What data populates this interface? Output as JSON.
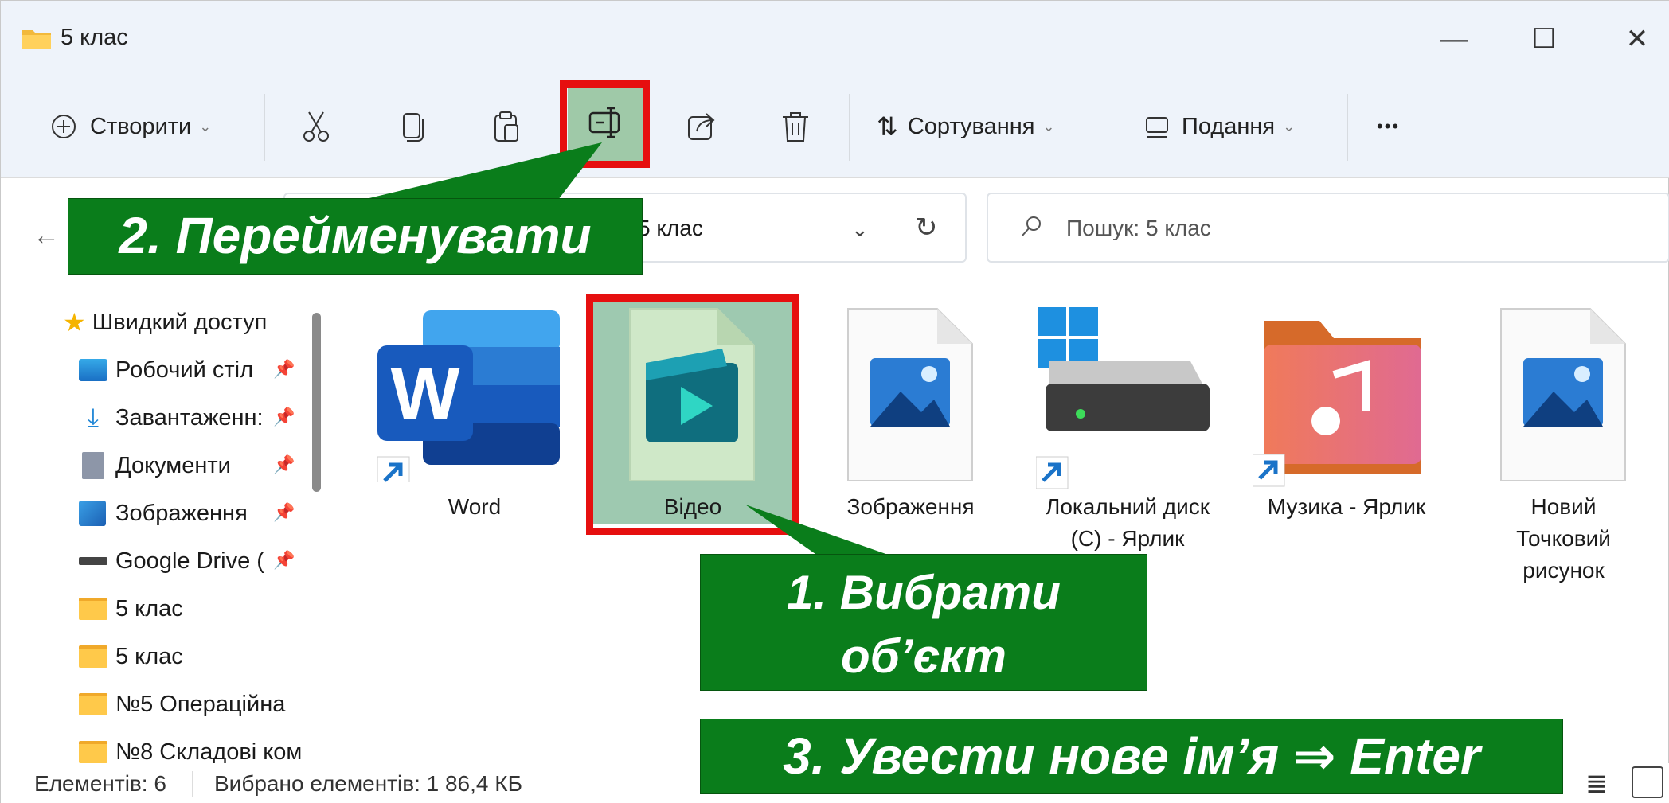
{
  "window": {
    "title": "5 клас",
    "controls": {
      "minimize": "—",
      "maximize": "☐",
      "close": "✕"
    }
  },
  "toolbar": {
    "create_label": "Створити",
    "sort_label": "Сортування",
    "view_label": "Подання",
    "more_label": "•••"
  },
  "address": {
    "path_visible": "5 клас",
    "search_placeholder": "Пошук: 5 клас"
  },
  "sidebar": {
    "items": [
      {
        "label": "Швидкий доступ",
        "icon": "star-icon"
      },
      {
        "label": "Робочий стіл",
        "icon": "desktop-icon",
        "pinned": true
      },
      {
        "label": "Завантаженн:",
        "icon": "download-icon",
        "pinned": true
      },
      {
        "label": "Документи",
        "icon": "document-icon",
        "pinned": true
      },
      {
        "label": "Зображення",
        "icon": "pictures-icon",
        "pinned": true
      },
      {
        "label": "Google Drive (",
        "icon": "drive-icon",
        "pinned": true
      },
      {
        "label": "5 клас",
        "icon": "folder-icon"
      },
      {
        "label": "5 клас",
        "icon": "folder-icon"
      },
      {
        "label": "№5 Операційна",
        "icon": "folder-icon"
      },
      {
        "label": "№8 Складові ком",
        "icon": "folder-icon"
      }
    ]
  },
  "files": [
    {
      "name": "Word",
      "icon": "word-icon",
      "shortcut": true
    },
    {
      "name": "Відео",
      "icon": "video-file-icon",
      "selected": true
    },
    {
      "name": "Зображення",
      "icon": "image-file-icon"
    },
    {
      "name_line1": "Локальний диск",
      "name_line2": "(C) - Ярлик",
      "icon": "local-disk-icon",
      "shortcut": true
    },
    {
      "name": "Музика - Ярлик",
      "icon": "music-folder-icon",
      "shortcut": true
    },
    {
      "name_line1": "Новий",
      "name_line2": "Точковий",
      "name_line3": "рисунок",
      "icon": "bitmap-file-icon"
    }
  ],
  "status": {
    "count": "Елементів: 6",
    "selected": "Вибрано елементів: 1  86,4 КБ"
  },
  "annotations": {
    "step1_line1": "1. Вибрати",
    "step1_line2": "об’єкт",
    "step2": "2. Перейменувати",
    "step3": "3. Увести нове ім’я ⇒ Enter"
  },
  "colors": {
    "callout_green": "#0a7d1b",
    "highlight_red": "#e60f0f",
    "selection": "#9ec9b0",
    "chrome": "#eef3fa"
  }
}
